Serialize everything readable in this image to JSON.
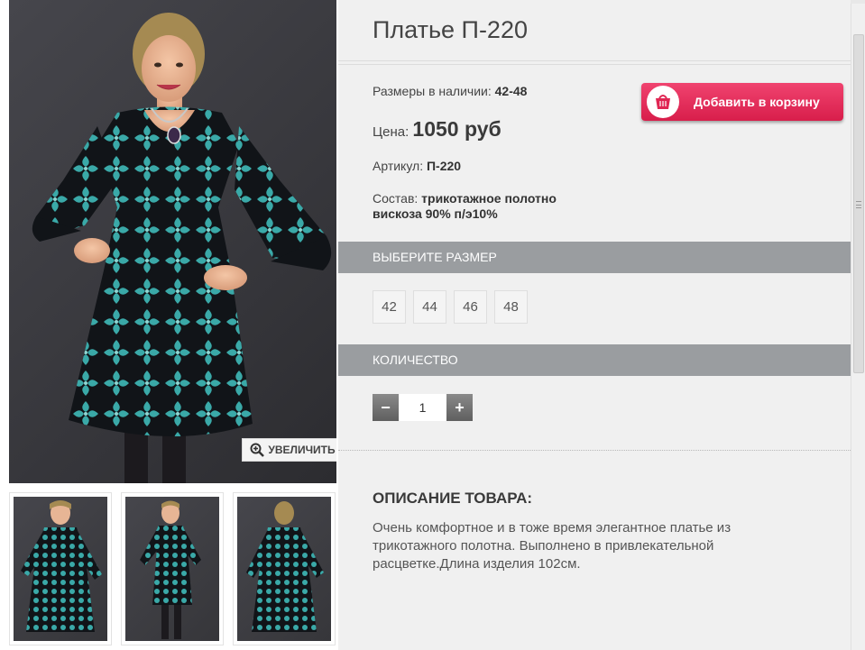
{
  "product": {
    "title": "Платье П-220",
    "sizes_label": "Размеры в наличии:",
    "sizes_value": "42-48",
    "price_label": "Цена:",
    "price_value": "1050 руб",
    "article_label": "Артикул:",
    "article_value": "П-220",
    "composition_label": "Состав:",
    "composition_line1": "трикотажное полотно",
    "composition_line2": "вискоза 90% п/э10%"
  },
  "cart_button": {
    "label": "Добавить в корзину",
    "icon": "basket-icon"
  },
  "gallery": {
    "zoom_label": "УВЕЛИЧИТЬ",
    "zoom_icon": "magnifier-plus-icon",
    "thumbnails": [
      "front-view",
      "side-view",
      "back-view"
    ]
  },
  "size_section": {
    "header": "ВЫБЕРИТЕ РАЗМЕР",
    "options": [
      "42",
      "44",
      "46",
      "48"
    ]
  },
  "quantity_section": {
    "header": "КОЛИЧЕСТВО",
    "minus": "−",
    "plus": "+",
    "value": "1"
  },
  "description": {
    "title": "ОПИСАНИЕ ТОВАРА:",
    "text": "Очень комфортное и в тоже время элегантное платье из трикотажного полотна. Выполнено в привлекательной расцветке.Длина изделия 102см."
  },
  "colors": {
    "cart_button": "#e02653",
    "section_header": "#9a9da0",
    "panel_bg": "#f0f0f0",
    "dress_teal": "#3aa9a8"
  }
}
